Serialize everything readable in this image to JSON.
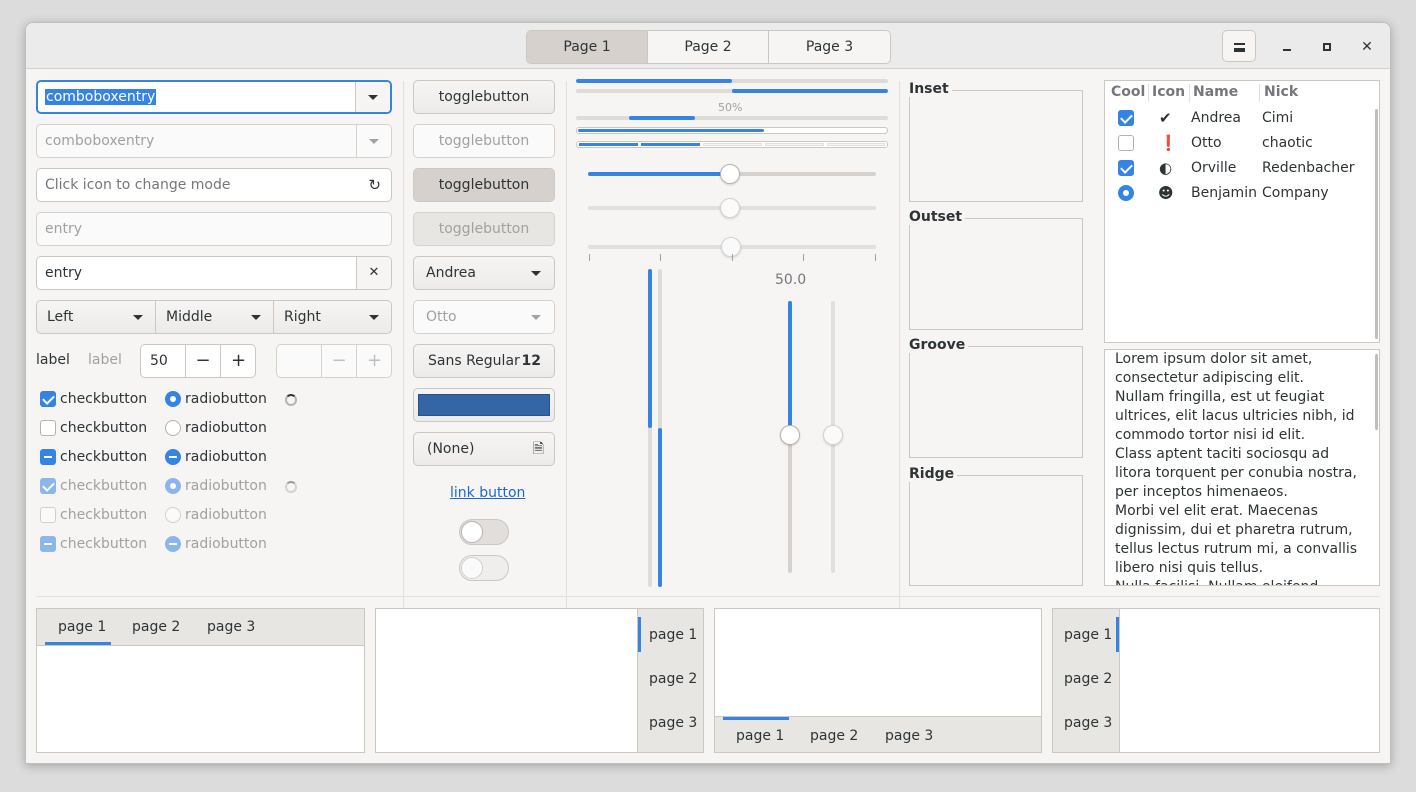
{
  "header": {
    "tabs": [
      "Page 1",
      "Page 2",
      "Page 3"
    ],
    "active_tab": "Page 1"
  },
  "col1": {
    "combo1_value": "comboboxentry",
    "combo2_value": "comboboxentry",
    "entry_mode_placeholder": "Click icon to change mode",
    "entry_disabled_placeholder": "entry",
    "entry_value": "entry",
    "dropdowns": [
      "Left",
      "Middle",
      "Right"
    ],
    "label1": "label",
    "label2": "label",
    "spin1_value": "50",
    "checks": [
      "checkbutton",
      "checkbutton",
      "checkbutton",
      "checkbutton",
      "checkbutton",
      "checkbutton"
    ],
    "radios": [
      "radiobutton",
      "radiobutton",
      "radiobutton",
      "radiobutton",
      "radiobutton",
      "radiobutton"
    ]
  },
  "col2": {
    "toggles": [
      "togglebutton",
      "togglebutton",
      "togglebutton",
      "togglebutton"
    ],
    "combo_andrea": "Andrea",
    "combo_otto": "Otto",
    "font_name": "Sans Regular",
    "font_size": "12",
    "color_swatch": "#3465a4",
    "file_none": "(None)",
    "link": "link button"
  },
  "col3": {
    "progress_label": "50%",
    "scale_value": "50.0",
    "progress_values": [
      0.5,
      1.0,
      0.22,
      0.6,
      0.4
    ],
    "hscale_values": [
      0.5,
      0.5,
      0.5
    ],
    "vscale_values": [
      0.5,
      0.5
    ]
  },
  "frames": [
    "Inset",
    "Outset",
    "Groove",
    "Ridge"
  ],
  "tree": {
    "columns": [
      "Cool",
      "Icon",
      "Name",
      "Nick"
    ],
    "rows": [
      {
        "name": "Andrea",
        "nick": "Cimi"
      },
      {
        "name": "Otto",
        "nick": "chaotic"
      },
      {
        "name": "Orville",
        "nick": "Redenbacher"
      },
      {
        "name": "Benjamin",
        "nick": "Company"
      }
    ]
  },
  "textview": "Lorem ipsum dolor sit amet, consectetur adipiscing elit.\nNullam fringilla, est ut feugiat ultrices, elit lacus ultricies nibh, id commodo tortor nisi id elit.\nClass aptent taciti sociosqu ad litora torquent per conubia nostra, per inceptos himenaeos.\nMorbi vel elit erat. Maecenas dignissim, dui et pharetra rutrum, tellus lectus rutrum mi, a convallis libero nisi quis tellus.\nNulla facilisi. Nullam eleifend lobortis",
  "notebooks": {
    "tabs": [
      "page 1",
      "page 2",
      "page 3"
    ]
  }
}
